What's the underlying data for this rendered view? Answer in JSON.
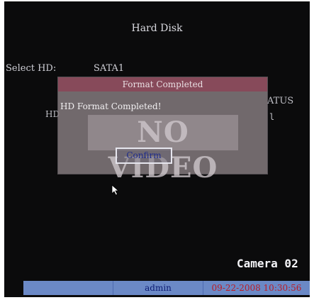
{
  "screen": {
    "title": "Hard Disk",
    "select_label": "Select HD:",
    "select_value": "SATA1",
    "background_left_text": "HD",
    "background_right_text": "ATUS",
    "background_right_text2": "l"
  },
  "dialog": {
    "title": "Format Completed",
    "message": "HD Format Completed!",
    "overlay_text": "NO VIDEO",
    "confirm_label": "Confirm"
  },
  "camera_label": "Camera 02",
  "status_bar": {
    "user": "admin",
    "datetime": "09-22-2008 10:30:56"
  },
  "colors": {
    "dialog_title_bg": "#874a5a",
    "status_bar_bg": "#6b89c6",
    "datetime_text": "#bb1c25",
    "user_text": "#0c1b73"
  },
  "icons": {
    "cursor": "mouse-pointer-icon"
  }
}
